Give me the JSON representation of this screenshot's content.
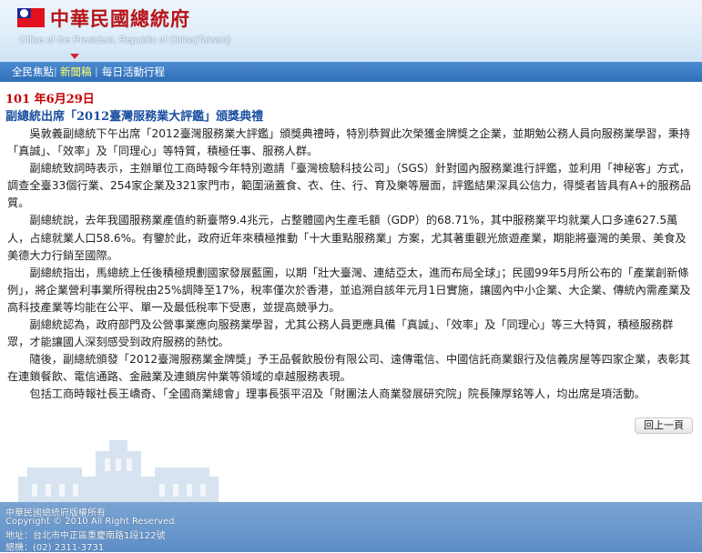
{
  "header": {
    "title": "中華民國總統府",
    "subtitle": "Office of the President, Republic of China(Taiwan)"
  },
  "nav": {
    "items": [
      {
        "label": "全民焦點",
        "active": false
      },
      {
        "label": "新聞稿",
        "active": true
      },
      {
        "label": "每日活動行程",
        "active": false
      }
    ]
  },
  "article": {
    "date": "101 年6月29日",
    "headline": "副總統出席「2012臺灣服務業大評鑑」頒獎典禮",
    "paragraphs": [
      "吳敦義副總統下午出席「2012臺灣服務業大評鑑」頒獎典禮時，特別恭賀此次榮獲金牌獎之企業，並期勉公務人員向服務業學習，秉持「真誠」、「效率」及「同理心」等特質，積極任事、服務人群。",
      "副總統致詞時表示，主辦單位工商時報今年特別邀請「臺灣檢驗科技公司」（SGS）針對國內服務業進行評鑑，並利用「神秘客」方式，調查全臺33個行業、254家企業及321家門市，範圍涵蓋食、衣、住、行、育及樂等層面，評鑑結果深具公信力，得獎者皆具有A+的服務品質。",
      "副總統說，去年我國服務業產值約新臺幣9.4兆元，占整體國內生產毛額（GDP）的68.71%，其中服務業平均就業人口多達627.5萬人，占總就業人口58.6%。有鑒於此，政府近年來積極推動「十大重點服務業」方案，尤其著重觀光旅遊產業，期能將臺灣的美景、美食及美德大力行銷至國際。",
      "副總統指出，馬總統上任後積極規劃國家發展藍圖，以期「壯大臺灣、連結亞太，進而布局全球」；民國99年5月所公布的「產業創新條例」，將企業營利事業所得稅由25%調降至17%，稅率僅次於香港，並追溯自該年元月1日實施，讓國內中小企業、大企業、傳統內需產業及高科技產業等均能在公平、單一及最低稅率下受惠，並提高競爭力。",
      "副總統認為，政府部門及公營事業應向服務業學習，尤其公務人員更應具備「真誠」、「效率」及「同理心」等三大特質，積極服務群眾，才能讓國人深刻感受到政府服務的熱忱。",
      "隨後，副總統頒發「2012臺灣服務業金牌獎」予王品餐飲股份有限公司、遠傳電信、中國信託商業銀行及信義房屋等四家企業，表彰其在連鎖餐飲、電信通路、金融業及連鎖房仲業等領域的卓越服務表現。",
      "包括工商時報社長王嶠奇、「全國商業總會」理事長張平沼及「財團法人商業發展研究院」院長陳厚銘等人，均出席是項活動。"
    ]
  },
  "back_button": {
    "label": "回上一頁"
  },
  "footer": {
    "lines": [
      "中華民國總統府版權所有",
      "Copyright © 2010 All Right Reserved.",
      "地址：台北市中正區重慶南路1段122號",
      "總機：(02) 2311-3731"
    ]
  },
  "colors": {
    "title_red": "#b8141a",
    "date_red": "#c40000",
    "headline_blue": "#1a4fa0",
    "nav_blue": "#2e6fb9",
    "nav_active": "#ffff66"
  }
}
